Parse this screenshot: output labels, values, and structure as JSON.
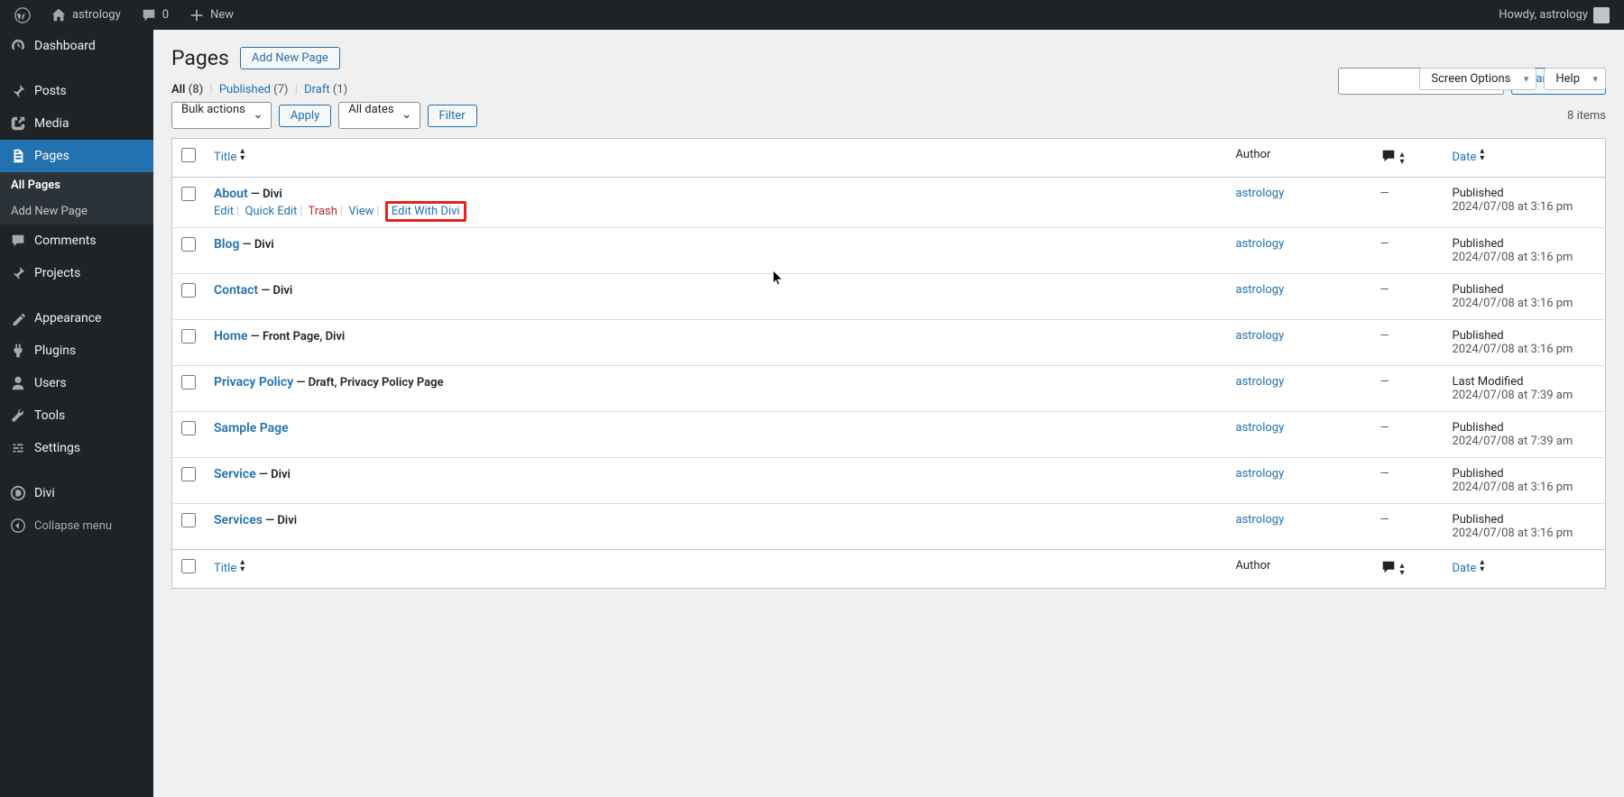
{
  "topbar": {
    "site_name": "astrology",
    "comments_count": "0",
    "new_label": "New",
    "greeting": "Howdy, astrology"
  },
  "sidebar": {
    "items": [
      {
        "icon": "dashboard",
        "label": "Dashboard"
      },
      {
        "icon": "pin",
        "label": "Posts"
      },
      {
        "icon": "media",
        "label": "Media"
      },
      {
        "icon": "pages",
        "label": "Pages"
      },
      {
        "icon": "comments",
        "label": "Comments"
      },
      {
        "icon": "pin",
        "label": "Projects"
      },
      {
        "icon": "appearance",
        "label": "Appearance"
      },
      {
        "icon": "plugins",
        "label": "Plugins"
      },
      {
        "icon": "users",
        "label": "Users"
      },
      {
        "icon": "tools",
        "label": "Tools"
      },
      {
        "icon": "settings",
        "label": "Settings"
      },
      {
        "icon": "divi",
        "label": "Divi"
      },
      {
        "icon": "collapse",
        "label": "Collapse menu"
      }
    ],
    "submenu": [
      "All Pages",
      "Add New Page"
    ]
  },
  "header": {
    "title": "Pages",
    "add_new": "Add New Page",
    "screen_options": "Screen Options",
    "help": "Help"
  },
  "filters": {
    "all": {
      "label": "All",
      "count": "(8)"
    },
    "published": {
      "label": "Published",
      "count": "(7)"
    },
    "draft": {
      "label": "Draft",
      "count": "(1)"
    }
  },
  "search": {
    "button": "Search Pages"
  },
  "actions": {
    "bulk": "Bulk actions",
    "apply": "Apply",
    "dates": "All dates",
    "filter": "Filter",
    "items_count": "8 items"
  },
  "columns": {
    "title": "Title",
    "author": "Author",
    "date": "Date"
  },
  "row_actions": {
    "edit": "Edit",
    "quick_edit": "Quick Edit",
    "trash": "Trash",
    "view": "View",
    "edit_divi": "Edit With Divi"
  },
  "rows": [
    {
      "title": "About",
      "suffix": " — Divi",
      "author": "astrology",
      "comments": "—",
      "status": "Published",
      "ts": "2024/07/08 at 3:16 pm"
    },
    {
      "title": "Blog",
      "suffix": " — Divi",
      "author": "astrology",
      "comments": "—",
      "status": "Published",
      "ts": "2024/07/08 at 3:16 pm"
    },
    {
      "title": "Contact",
      "suffix": " — Divi",
      "author": "astrology",
      "comments": "—",
      "status": "Published",
      "ts": "2024/07/08 at 3:16 pm"
    },
    {
      "title": "Home",
      "suffix": " — Front Page, Divi",
      "author": "astrology",
      "comments": "—",
      "status": "Published",
      "ts": "2024/07/08 at 3:16 pm"
    },
    {
      "title": "Privacy Policy",
      "suffix": " — Draft, Privacy Policy Page",
      "author": "astrology",
      "comments": "—",
      "status": "Last Modified",
      "ts": "2024/07/08 at 7:39 am"
    },
    {
      "title": "Sample Page",
      "suffix": "",
      "author": "astrology",
      "comments": "—",
      "status": "Published",
      "ts": "2024/07/08 at 7:39 am"
    },
    {
      "title": "Service",
      "suffix": " — Divi",
      "author": "astrology",
      "comments": "—",
      "status": "Published",
      "ts": "2024/07/08 at 3:16 pm"
    },
    {
      "title": "Services",
      "suffix": " — Divi",
      "author": "astrology",
      "comments": "—",
      "status": "Published",
      "ts": "2024/07/08 at 3:16 pm"
    }
  ]
}
